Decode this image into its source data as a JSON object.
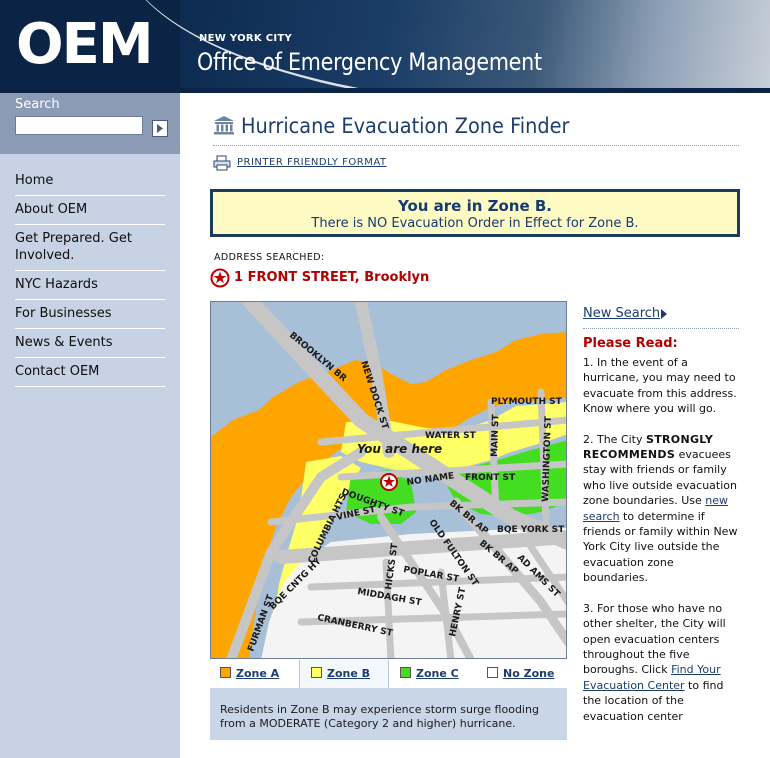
{
  "header": {
    "logo": "OEM",
    "subtitle": "NEW YORK CITY",
    "title": "Office of Emergency Management"
  },
  "search": {
    "label": "Search",
    "value": "",
    "button_icon": "arrow-right-icon"
  },
  "nav": {
    "items": [
      {
        "label": "Home"
      },
      {
        "label": "About OEM"
      },
      {
        "label": "Get Prepared. Get Involved."
      },
      {
        "label": "NYC Hazards"
      },
      {
        "label": "For Businesses"
      },
      {
        "label": "News & Events"
      },
      {
        "label": "Contact OEM"
      }
    ]
  },
  "main": {
    "title": "Hurricane Evacuation Zone Finder",
    "title_icon": "building-icon",
    "printer_link": "PRINTER FRIENDLY FORMAT",
    "zone_box": {
      "line1": "You are in Zone B.",
      "line2": "There is NO Evacuation Order in Effect for Zone B."
    },
    "address_label": "ADDRESS SEARCHED:",
    "address_value": "1 FRONT STREET, Brooklyn"
  },
  "map": {
    "you_are_here": "You are here",
    "streets": {
      "brooklyn_br": "BROOKLYN BR",
      "new_dock_st": "NEW DOCK ST",
      "plymouth_st": "PLYMOUTH ST",
      "water_st": "WATER ST",
      "main_st": "MAIN ST",
      "washington_st": "WASHINGTON ST",
      "front_st": "FRONT ST",
      "no_name": "NO NAME",
      "doughty_st": "DOUGHTY ST",
      "vine_st": "VINE ST",
      "bk_br_ap_1": "BK BR AP",
      "bk_br_ap_2": "BK BR AP",
      "bqe_york_st": "BQE YORK ST",
      "columbia_hts": "COLUMBIA HTS",
      "old_fulton_st": "OLD FULTON ST",
      "bqe_cntg_hy": "BQE CNTG HY",
      "hicks_st": "HICKS ST",
      "poplar_st": "POPLAR ST",
      "adams_st": "AD AMS ST",
      "middagh_st": "MIDDAGH ST",
      "henry_st": "HENRY ST",
      "furman_st": "FURMAN ST",
      "cranberry_st": "CRANBERRY ST"
    },
    "colors": {
      "water": "#a8bfd8",
      "zone_a": "#ffa500",
      "zone_b": "#ffff66",
      "zone_c": "#44dd22",
      "no_zone": "#f4f4f4",
      "roads": "#c6c6c6"
    }
  },
  "legend": {
    "items": [
      {
        "label": "Zone A",
        "color": "#ffa500"
      },
      {
        "label": "Zone B",
        "color": "#ffff66"
      },
      {
        "label": "Zone C",
        "color": "#44dd22"
      },
      {
        "label": "No Zone",
        "color": "#ffffff"
      }
    ],
    "active": "Zone B",
    "info": "Residents in Zone B may experience storm surge flooding from a MODERATE (Category 2 and higher) hurricane."
  },
  "right": {
    "new_search": "New Search",
    "please_read": "Please Read:",
    "p1": "1. In the event of a hurricane, you may need to evacuate from this address. Know where you will go.",
    "p2_a": "2. The City ",
    "p2_strong": "STRONGLY RECOMMENDS",
    "p2_b": " evacuees stay with friends or family who live outside evacuation zone boundaries. Use ",
    "p2_link": "new search",
    "p2_c": " to determine if friends or family within New York City live outside the evacuation zone boundaries.",
    "p3_a": "3. For those who have no other shelter, the City will open evacuation centers throughout the five boroughs. Click ",
    "p3_link": "Find Your Evacuation Center",
    "p3_b": " to find the location of the evacuation center"
  }
}
